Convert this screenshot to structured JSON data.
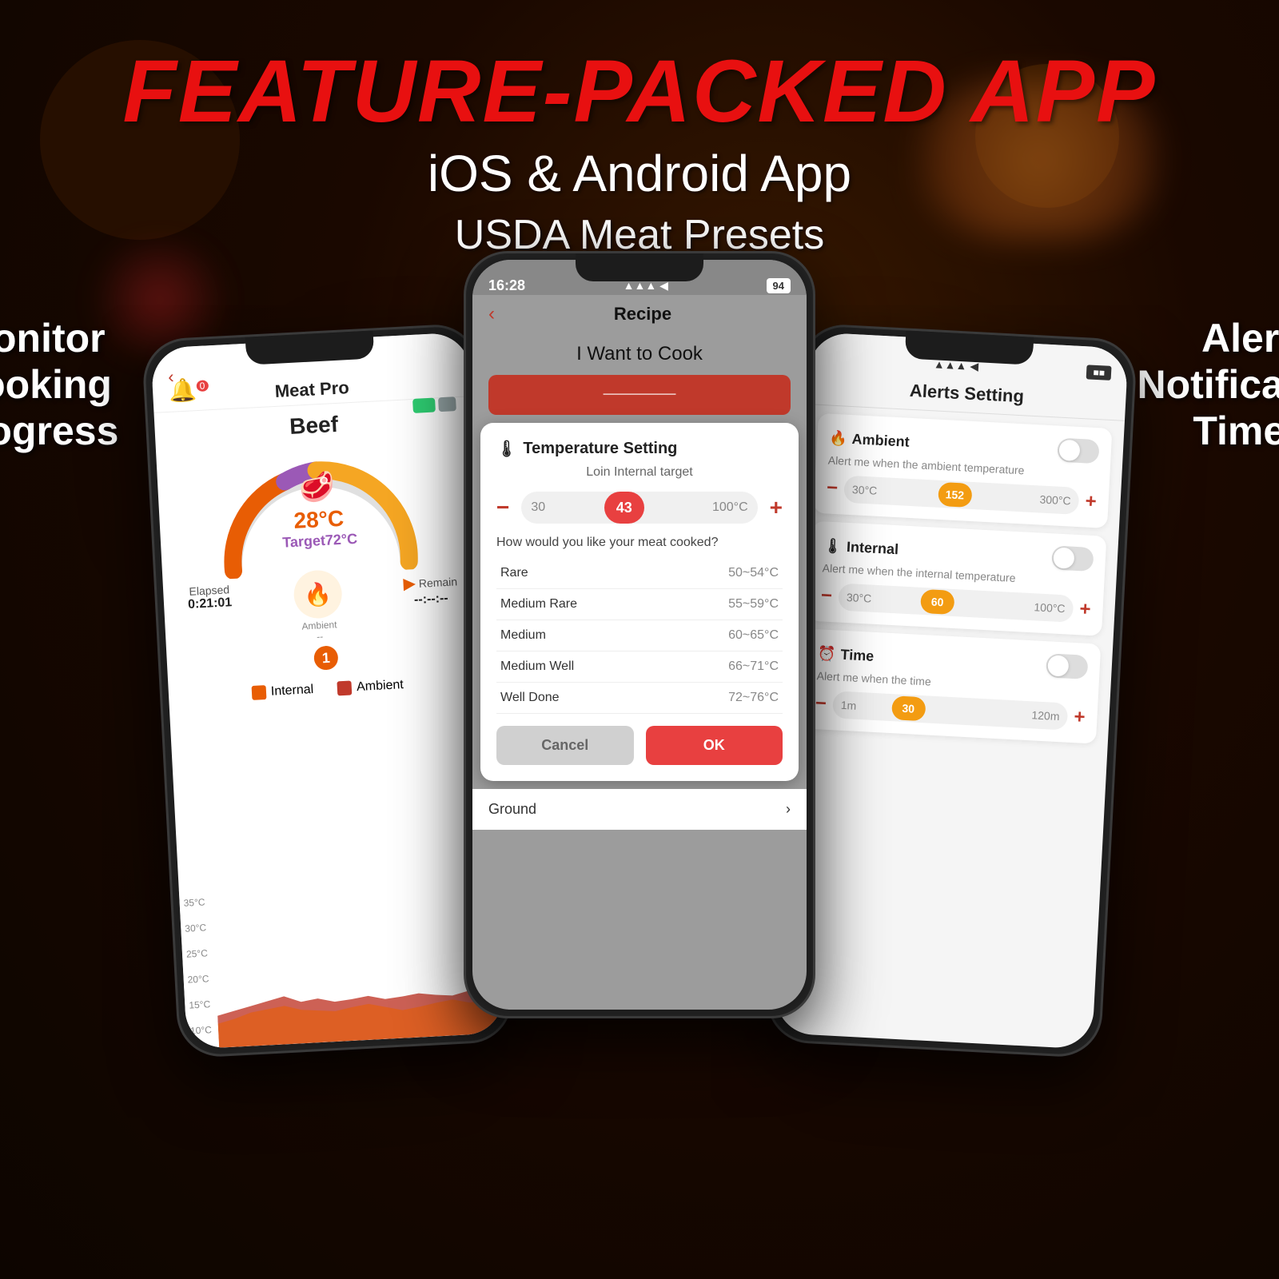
{
  "page": {
    "background_color": "#1a0800"
  },
  "header": {
    "main_title": "FEATURE-PACKED APP",
    "subtitle": "iOS & Android App"
  },
  "labels": {
    "left": "Monitor\nCooking Progress",
    "center": "USDA Meat Presets",
    "right": "Alert Notification\nTimer"
  },
  "left_phone": {
    "app_name": "Meat Pro",
    "screen_title": "Meat Pro",
    "back_label": "‹",
    "food_type": "Beef",
    "current_temp": "28°C",
    "target_temp": "Target72°C",
    "elapsed_label": "Elapsed",
    "elapsed_value": "0:21:01",
    "remain_label": "Remain",
    "remain_value": "--:--:--",
    "ambient_label": "Ambient",
    "legend": {
      "internal_label": "Internal",
      "ambient_label": "Ambient",
      "internal_color": "#e85d04",
      "ambient_color": "#c0392b"
    },
    "y_axis": [
      "35°C",
      "30°C",
      "25°C",
      "20°C",
      "15°C",
      "10°C"
    ]
  },
  "center_phone": {
    "time": "16:28",
    "battery": "94",
    "back_label": "‹",
    "screen_title": "Recipe",
    "i_want_to_cook": "I Want to Cook",
    "dialog": {
      "title": "Temperature Setting",
      "subtitle": "Loin Internal target",
      "min_temp": "30",
      "max_temp": "100°C",
      "current_value": "43",
      "cook_question": "How would you like your meat cooked?",
      "doneness": [
        {
          "name": "Rare",
          "range": "50~54°C"
        },
        {
          "name": "Medium Rare",
          "range": "55~59°C"
        },
        {
          "name": "Medium",
          "range": "60~65°C"
        },
        {
          "name": "Medium Well",
          "range": "66~71°C"
        },
        {
          "name": "Well Done",
          "range": "72~76°C"
        }
      ],
      "cancel_label": "Cancel",
      "ok_label": "OK"
    },
    "ground_label": "Ground"
  },
  "right_phone": {
    "screen_title": "Alerts Setting",
    "alerts": [
      {
        "icon": "🔥",
        "title": "Ambient",
        "description": "Alert me when the ambient temperature",
        "range_start": "30°C",
        "range_value": "152",
        "range_end": "300°C",
        "thumb_color": "#f39c12"
      },
      {
        "icon": "🌡",
        "title": "Internal",
        "description": "Alert me when the internal temperature",
        "range_start": "30°C",
        "range_value": "60",
        "range_end": "100°C",
        "thumb_color": "#f39c12"
      },
      {
        "icon": "⏰",
        "title": "Time",
        "description": "Alert me when the time",
        "range_start": "1m",
        "range_value": "30",
        "range_end": "120m",
        "thumb_color": "#f39c12"
      }
    ]
  }
}
